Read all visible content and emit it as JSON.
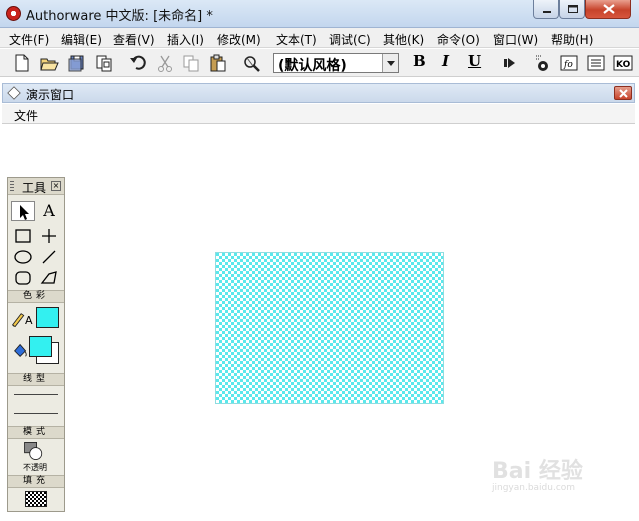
{
  "window": {
    "title": "Authorware 中文版: [未命名] *"
  },
  "menubar": {
    "items": [
      "文件(F)",
      "编辑(E)",
      "查看(V)",
      "插入(I)",
      "修改(M)",
      "文本(T)",
      "调试(C)",
      "其他(K)",
      "命令(O)",
      "窗口(W)",
      "帮助(H)"
    ]
  },
  "toolbar": {
    "style_value": "(默认风格)",
    "bold_label": "B",
    "italic_label": "I",
    "underline_label": "U",
    "ko_label": "KO"
  },
  "presentation": {
    "title": "演示窗口",
    "menu_file": "文件"
  },
  "palette": {
    "title": "工具",
    "close": "×",
    "section_color": "色彩",
    "section_line": "线型",
    "section_mode": "模式",
    "section_fill": "填充",
    "mode_value": "不透明",
    "text_tool": "A",
    "color_text_label": "A"
  },
  "watermark": {
    "main": "Bai 经验",
    "sub": "jingyan.baidu.com"
  },
  "colors": {
    "fill_color": "#33f0f0",
    "title_gradient_top": "#dbe8f6",
    "close_button": "#c7432b"
  }
}
